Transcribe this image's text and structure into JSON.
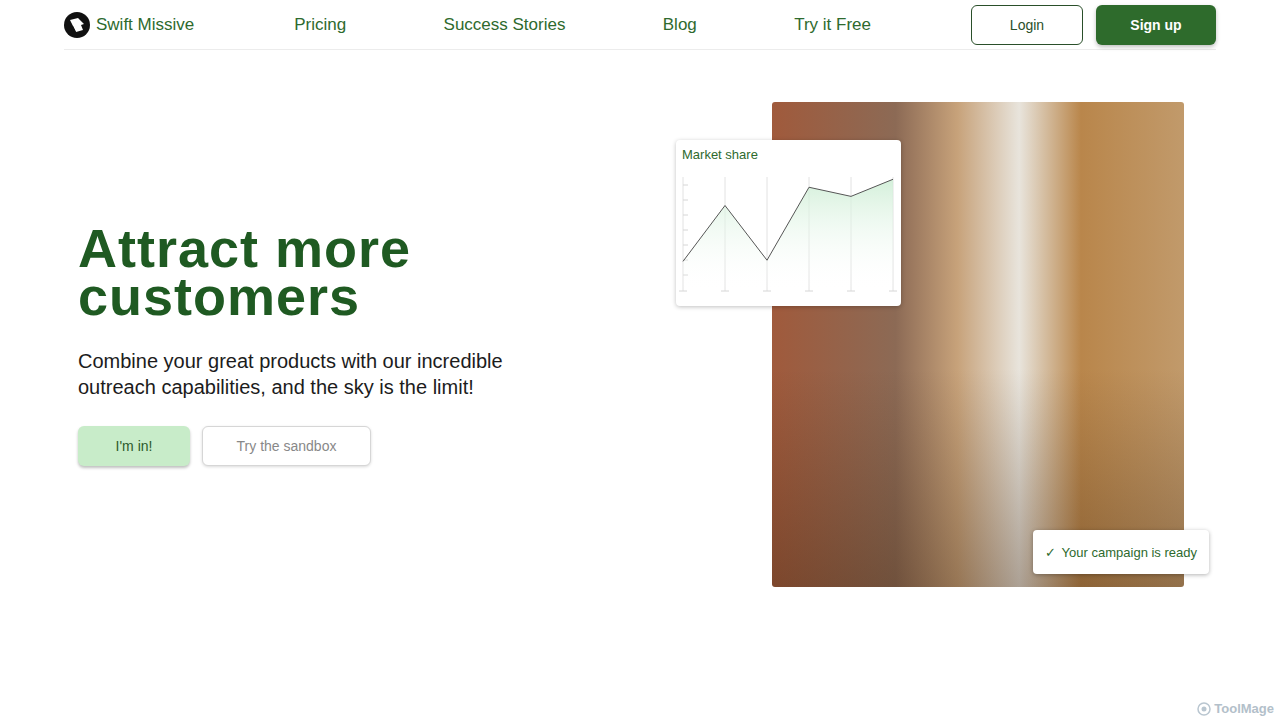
{
  "brand": {
    "name": "Swift Missive"
  },
  "nav": {
    "links": [
      "Pricing",
      "Success Stories",
      "Blog",
      "Try it Free"
    ],
    "login": "Login",
    "signup": "Sign up"
  },
  "hero": {
    "title": "Attract more customers",
    "subtitle": "Combine your great products with our incredible outreach capabilities, and the sky is the limit!",
    "primary": "I'm in!",
    "secondary": "Try the sandbox"
  },
  "chart": {
    "title": "Market share",
    "series": [
      {
        "name": "share",
        "values": [
          26,
          75,
          27,
          91,
          83,
          98
        ]
      }
    ]
  },
  "toast": {
    "icon": "✓",
    "text": "Your campaign is ready"
  },
  "watermark": "ToolMage"
}
